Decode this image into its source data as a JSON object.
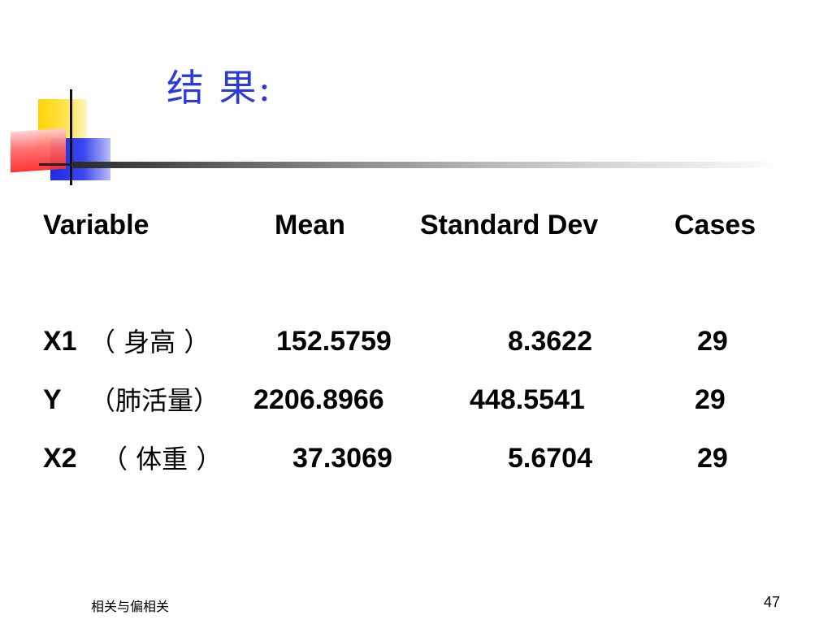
{
  "title": "结  果:",
  "table": {
    "headers": {
      "variable": "Variable",
      "mean": "Mean",
      "std": "Standard Dev",
      "cases": "Cases"
    },
    "rows": [
      {
        "var_code": "X1",
        "var_label": "（ 身高 ）",
        "mean": "152.5759",
        "std": "8.3622",
        "cases": "29"
      },
      {
        "var_code": "Y",
        "var_label": "（肺活量）",
        "mean": "2206.8966",
        "std": "448.5541",
        "cases": "29"
      },
      {
        "var_code": "X2",
        "var_label": "（ 体重 ）",
        "mean": "37.3069",
        "std": "5.6704",
        "cases": "29"
      }
    ]
  },
  "footer": {
    "left": "相关与偏相关",
    "page_number": "47"
  },
  "colors": {
    "title": "#2b3bd8",
    "deco_yellow": "#ffd400",
    "deco_blue": "#1f2be0",
    "deco_red": "#ff2a2a"
  }
}
